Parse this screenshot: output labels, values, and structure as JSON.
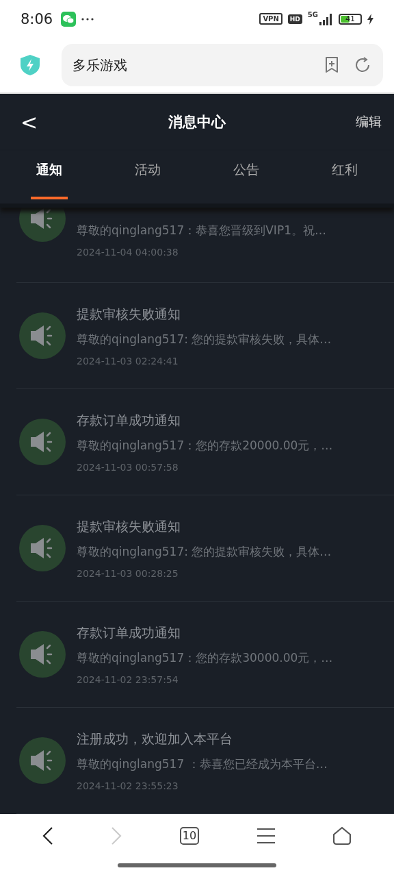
{
  "status_bar": {
    "time": "8:06",
    "vpn": "VPN",
    "hd": "HD",
    "network": "5G",
    "battery": "41"
  },
  "address_bar": {
    "value": "多乐游戏"
  },
  "header": {
    "back": "<",
    "title": "消息中心",
    "action": "编辑"
  },
  "tabs": [
    {
      "label": "通知",
      "selected": true
    },
    {
      "label": "活动",
      "selected": false
    },
    {
      "label": "公告",
      "selected": false
    },
    {
      "label": "红利",
      "selected": false
    }
  ],
  "messages": [
    {
      "body": "尊敬的qinglang517：恭喜您晋级到VIP1。祝…",
      "time": "2024-11-04 04:00:38"
    },
    {
      "title": "提款审核失败通知",
      "body": "尊敬的qinglang517: 您的提款审核失败，具体…",
      "time": "2024-11-03 02:24:41"
    },
    {
      "title": "存款订单成功通知",
      "body": "尊敬的qinglang517：您的存款20000.00元，…",
      "time": "2024-11-03 00:57:58"
    },
    {
      "title": "提款审核失败通知",
      "body": "尊敬的qinglang517: 您的提款审核失败，具体…",
      "time": "2024-11-03 00:28:25"
    },
    {
      "title": "存款订单成功通知",
      "body": "尊敬的qinglang517：您的存款30000.00元，…",
      "time": "2024-11-02 23:57:54"
    },
    {
      "title": "注册成功，欢迎加入本平台",
      "body": "尊敬的qinglang517 ：恭喜您已经成为本平台…",
      "time": "2024-11-02 23:55:23"
    }
  ],
  "browser_nav": {
    "forward_disabled": true,
    "tab_count": "10"
  }
}
